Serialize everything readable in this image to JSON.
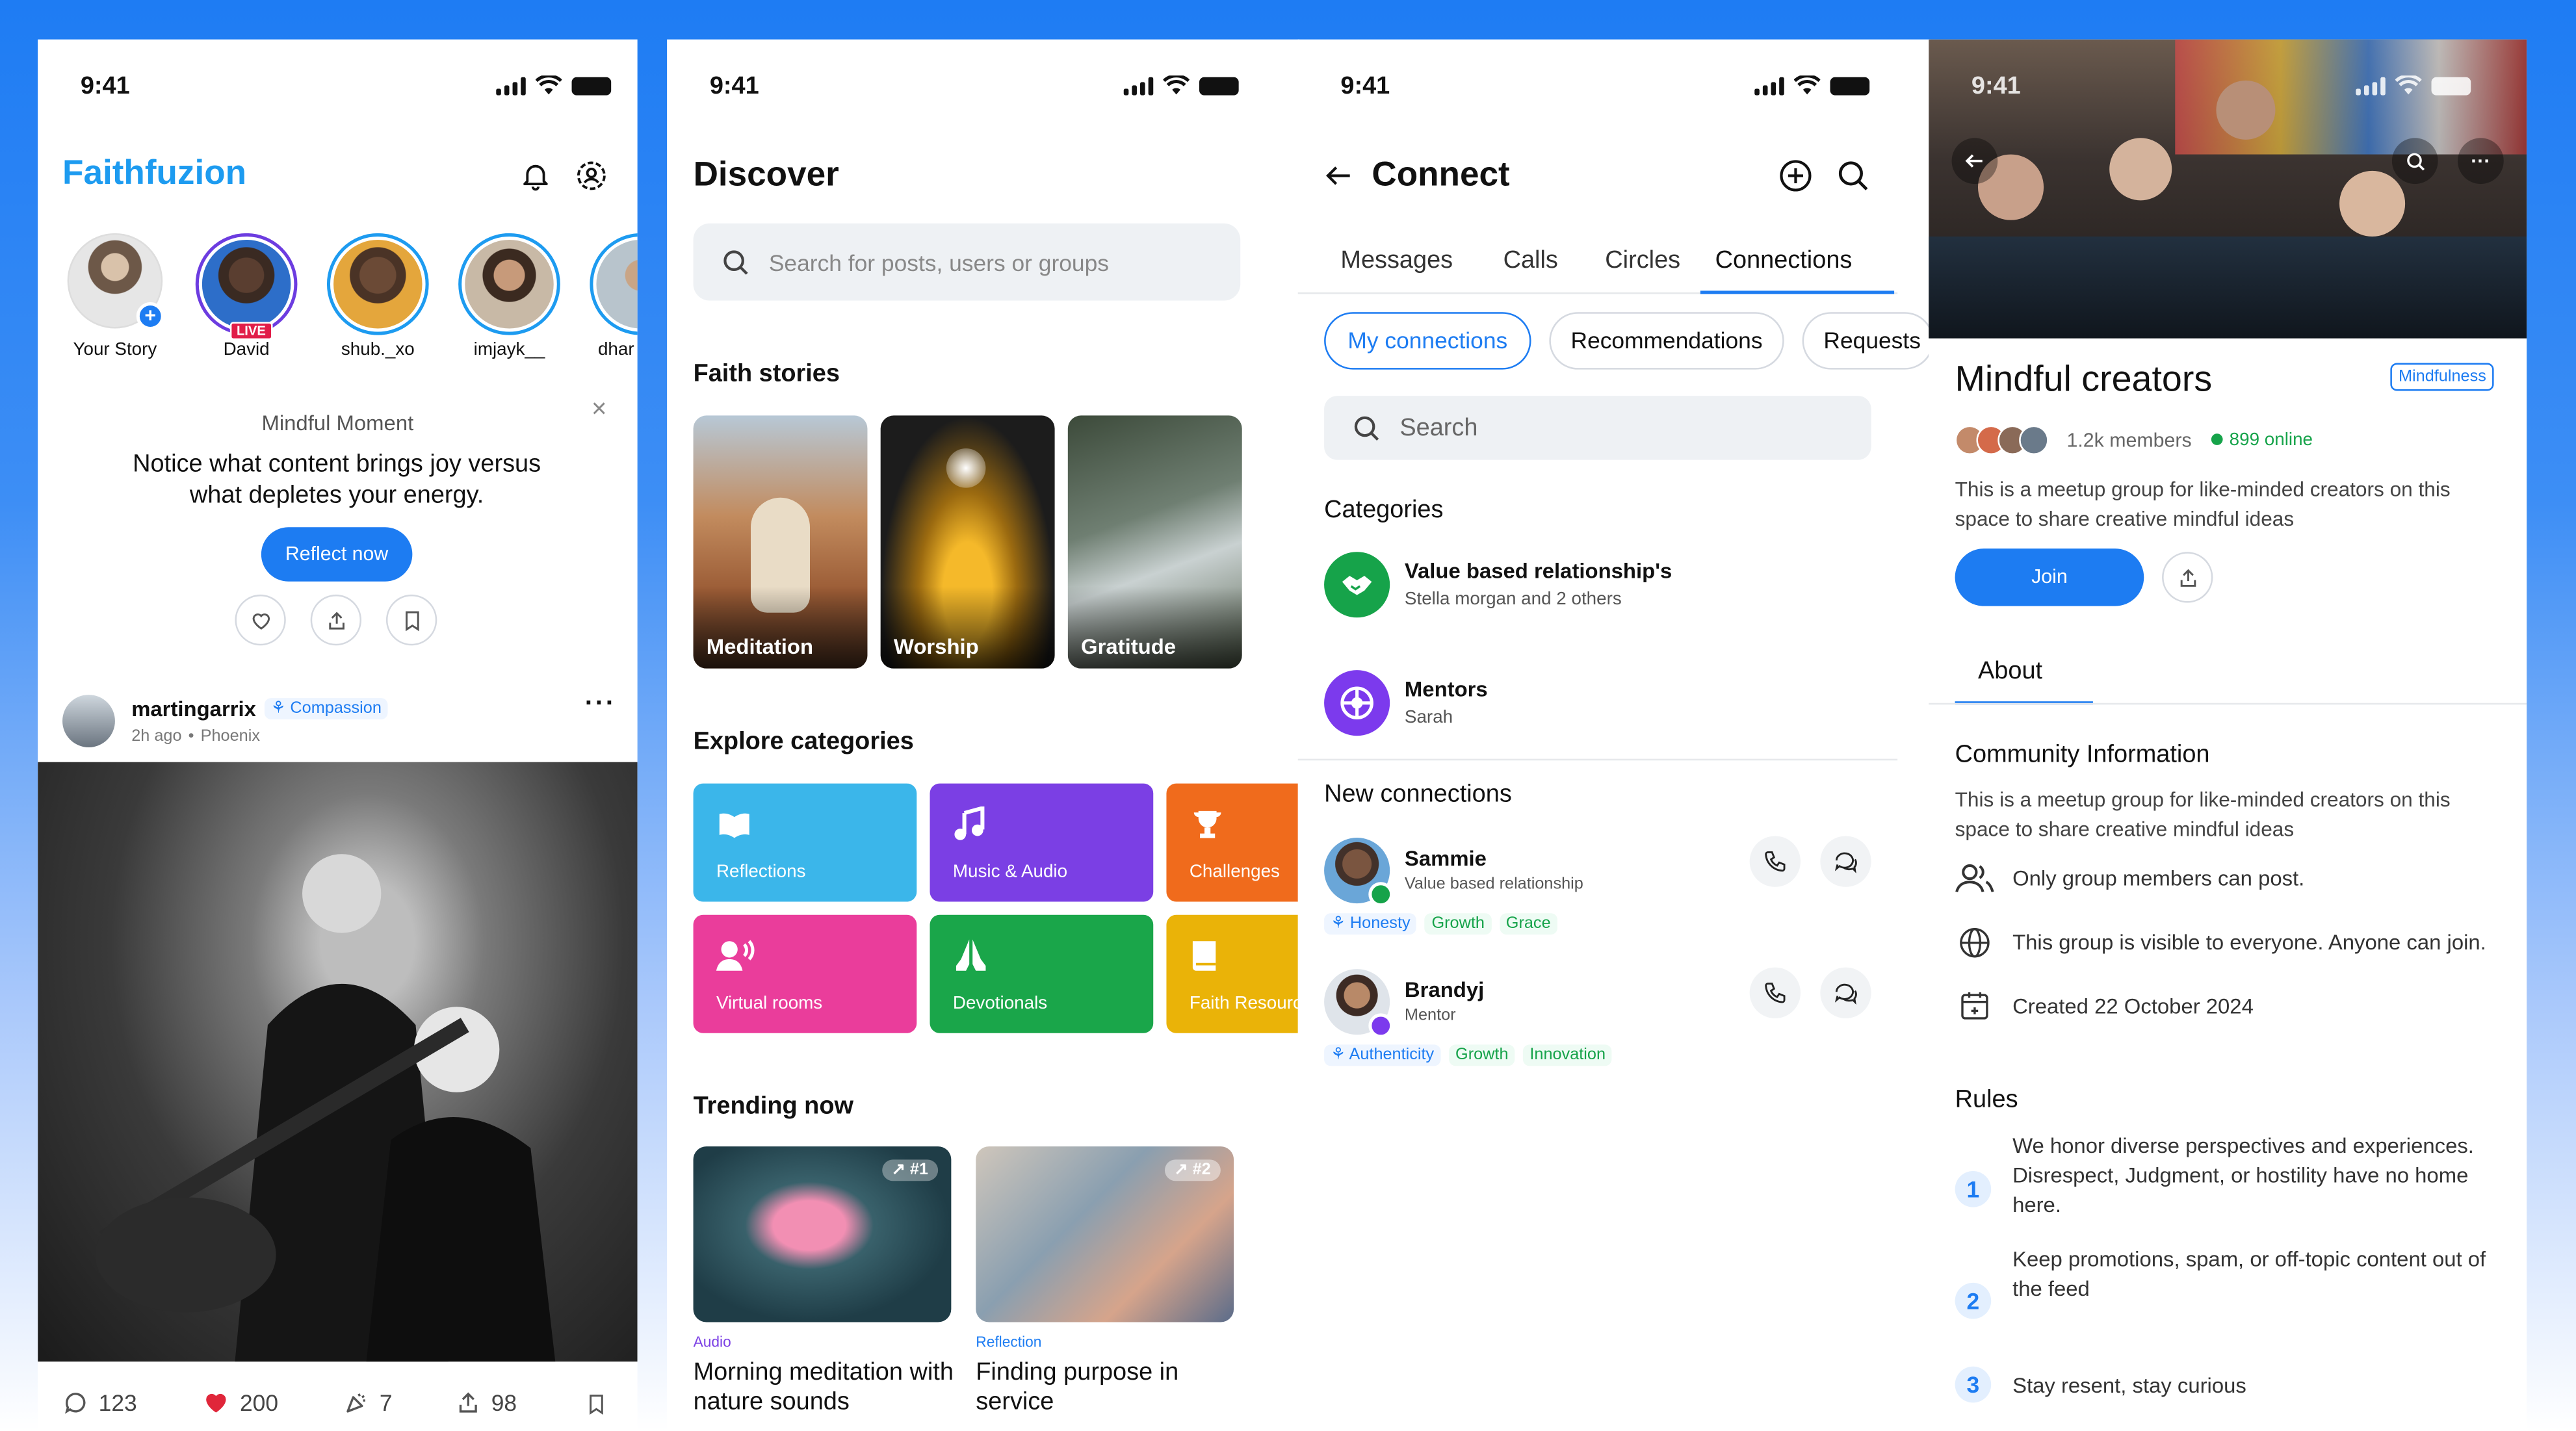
{
  "status_time": "9:41",
  "feed": {
    "brand": "Faithfuzion",
    "stories": [
      {
        "name": "Your Story"
      },
      {
        "name": "David",
        "badge": "LIVE"
      },
      {
        "name": "shub._xo"
      },
      {
        "name": "imjayk__"
      },
      {
        "name": "dhar"
      }
    ],
    "mindful": {
      "heading": "Mindful Moment",
      "text": "Notice what content brings joy versus what depletes your energy.",
      "button": "Reflect now"
    },
    "post": {
      "author": "martingarrix",
      "tag": "Compassion",
      "time": "2h ago",
      "location": "Phoenix",
      "comments": "123",
      "likes": "200",
      "celebrates": "7",
      "shares": "98"
    }
  },
  "discover": {
    "title": "Discover",
    "search_placeholder": "Search for posts, users or groups",
    "faith_heading": "Faith stories",
    "faith_cards": [
      "Meditation",
      "Worship",
      "Gratitude"
    ],
    "explore_heading": "Explore categories",
    "categories": [
      {
        "label": "Reflections",
        "color": "#3bb6ea"
      },
      {
        "label": "Music & Audio",
        "color": "#7b3fe4"
      },
      {
        "label": "Challenges",
        "color": "#f06b1c"
      },
      {
        "label": "Virtual rooms",
        "color": "#ea3d9b"
      },
      {
        "label": "Devotionals",
        "color": "#1aa64a"
      },
      {
        "label": "Faith Resourc",
        "color": "#eab308"
      }
    ],
    "trending_heading": "Trending now",
    "trending": [
      {
        "rank": "#1",
        "category": "Audio",
        "title": "Morning meditation with nature sounds"
      },
      {
        "rank": "#2",
        "category": "Reflection",
        "title": "Finding purpose in service"
      }
    ]
  },
  "connect": {
    "title": "Connect",
    "tabs": [
      "Messages",
      "Calls",
      "Circles",
      "Connections"
    ],
    "filters": [
      "My connections",
      "Recommendations",
      "Requests"
    ],
    "search_placeholder": "Search",
    "categories_heading": "Categories",
    "categories": [
      {
        "name": "Value based relationship's",
        "sub": "Stella morgan and 2 others",
        "color": "#16a34a"
      },
      {
        "name": "Mentors",
        "sub": "Sarah",
        "color": "#7c3aed"
      }
    ],
    "new_heading": "New connections",
    "people": [
      {
        "name": "Sammie",
        "sub": "Value based relationship",
        "tags": [
          "Honesty",
          "Growth",
          "Grace"
        ]
      },
      {
        "name": "Brandyj",
        "sub": "Mentor",
        "tags": [
          "Authenticity",
          "Growth",
          "Innovation"
        ]
      }
    ]
  },
  "group": {
    "title": "Mindful creators",
    "badge": "Mindfulness",
    "members": "1.2k members",
    "online": "899 online",
    "description": "This is a meetup group for like-minded creators on this space to share creative mindful ideas",
    "join": "Join",
    "tab": "About",
    "info_heading": "Community Information",
    "info_text": "This is a meetup group for like-minded creators on this space to share creative mindful ideas",
    "info_rows": [
      "Only group members can post.",
      "This group is visible to everyone.  Anyone can join.",
      "Created 22 October 2024"
    ],
    "rules_heading": "Rules",
    "rules": [
      {
        "num": "1",
        "text": "We honor diverse perspectives and experiences. Disrespect, Judgment, or hostility have no home here."
      },
      {
        "num": "2",
        "text": "Keep promotions, spam, or off-topic content out of the feed"
      },
      {
        "num": "3",
        "text": "Stay resent, stay curious"
      }
    ]
  }
}
